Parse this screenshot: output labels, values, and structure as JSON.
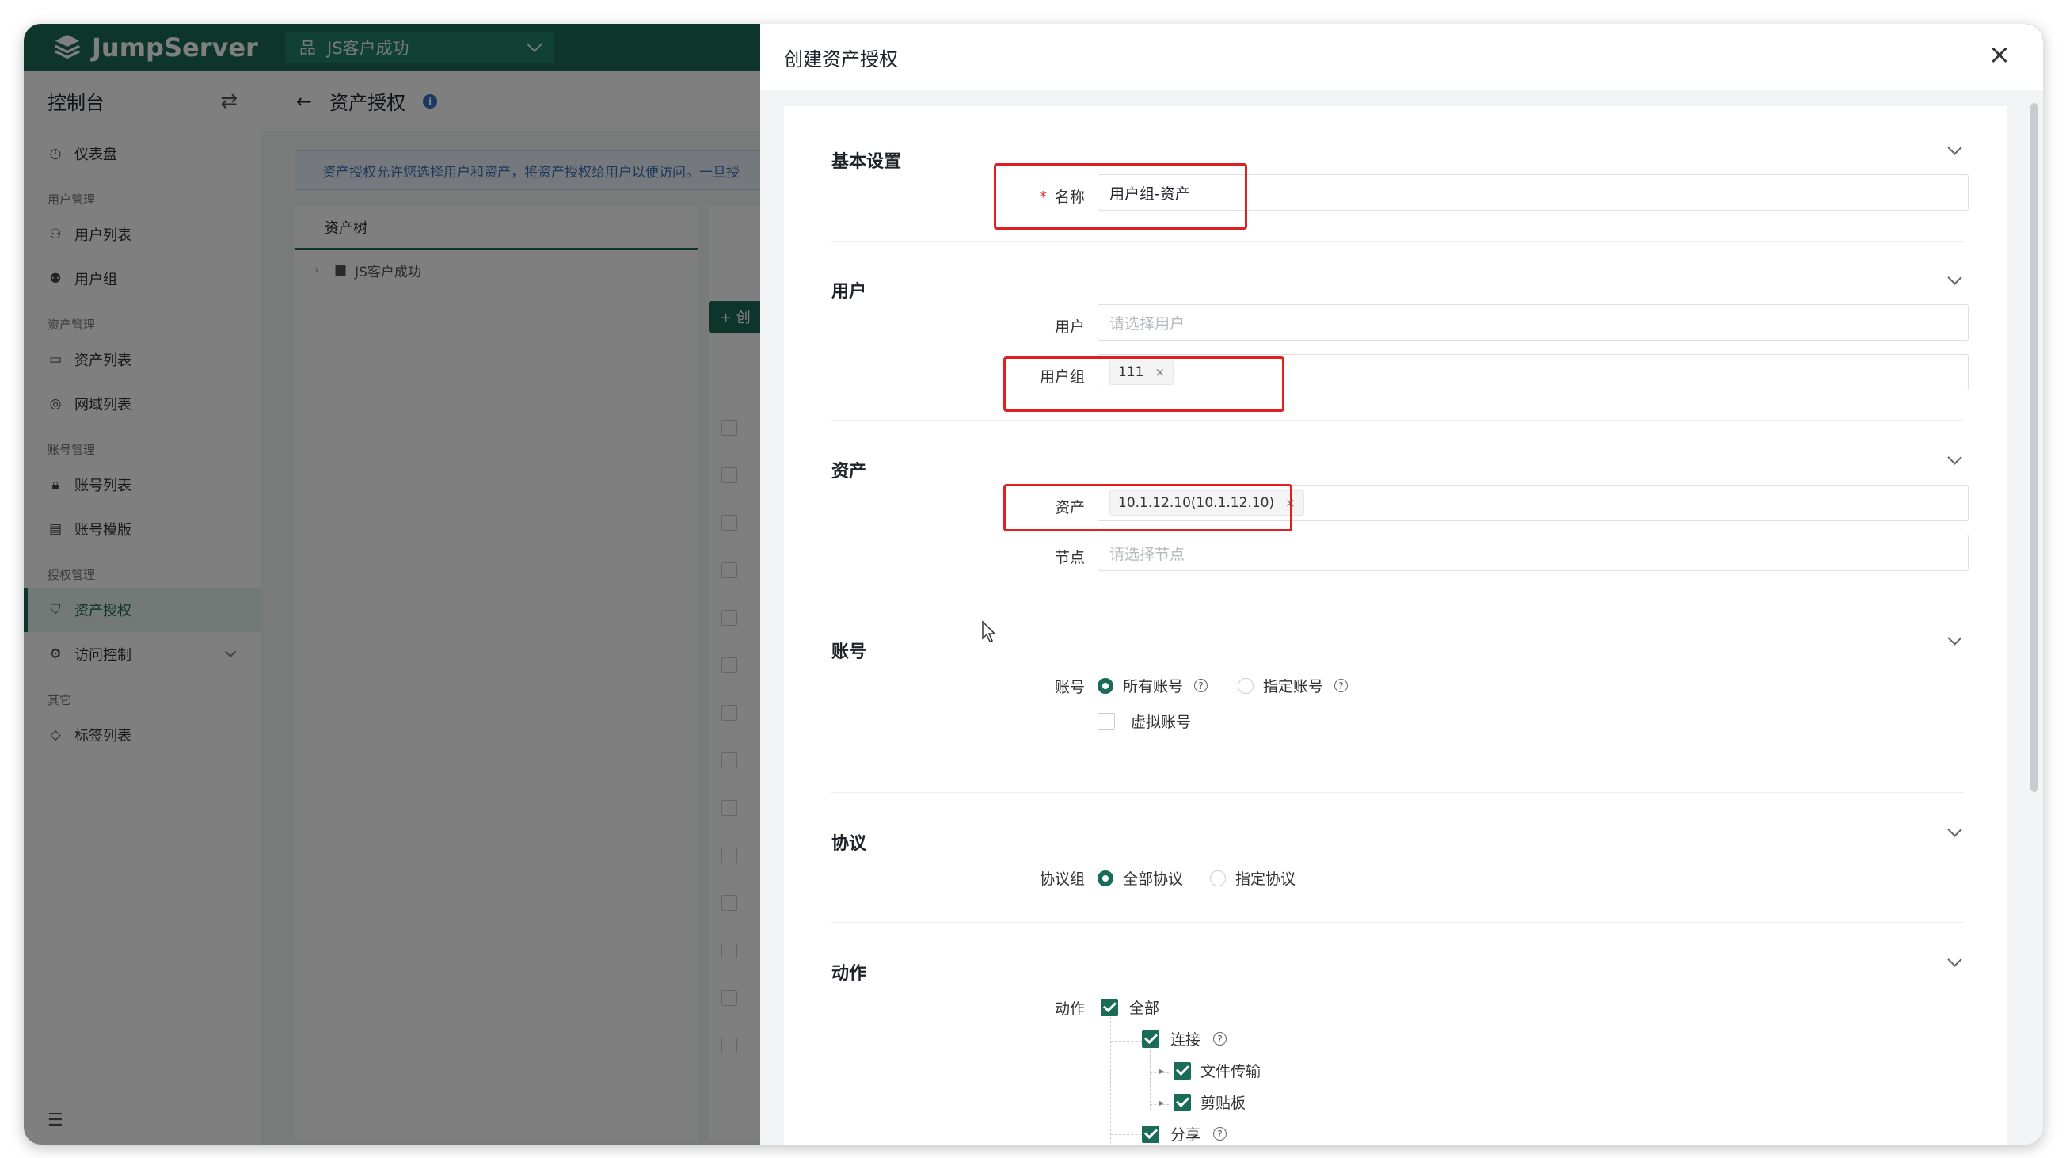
{
  "app": {
    "logo": "JumpServer",
    "org": "JS客户成功"
  },
  "sidebar": {
    "title": "控制台",
    "items": [
      {
        "type": "item",
        "label": "仪表盘",
        "icon": "dashboard-icon"
      },
      {
        "type": "group",
        "label": "用户管理"
      },
      {
        "type": "item",
        "label": "用户列表",
        "icon": "user-icon"
      },
      {
        "type": "item",
        "label": "用户组",
        "icon": "user-group-icon"
      },
      {
        "type": "group",
        "label": "资产管理"
      },
      {
        "type": "item",
        "label": "资产列表",
        "icon": "monitor-icon"
      },
      {
        "type": "item",
        "label": "网域列表",
        "icon": "location-icon"
      },
      {
        "type": "group",
        "label": "账号管理"
      },
      {
        "type": "item",
        "label": "账号列表",
        "icon": "lock-icon"
      },
      {
        "type": "item",
        "label": "账号模版",
        "icon": "template-icon"
      },
      {
        "type": "group",
        "label": "授权管理"
      },
      {
        "type": "item",
        "label": "资产授权",
        "icon": "shield-icon",
        "active": true
      },
      {
        "type": "item",
        "label": "访问控制",
        "icon": "access-control-icon",
        "expandable": true
      },
      {
        "type": "group",
        "label": "其它"
      },
      {
        "type": "item",
        "label": "标签列表",
        "icon": "tag-icon"
      }
    ]
  },
  "page": {
    "title": "资产授权",
    "notice": "资产授权允许您选择用户和资产，将资产授权给用户以便访问。一旦授",
    "tree_tab": "资产树",
    "tree_root": "JS客户成功",
    "create_label": "+ 创"
  },
  "drawer": {
    "title": "创建资产授权",
    "sections": {
      "basic": {
        "title": "基本设置",
        "name_label": "名称",
        "name_value": "用户组-资产"
      },
      "users": {
        "title": "用户",
        "user_label": "用户",
        "user_placeholder": "请选择用户",
        "group_label": "用户组",
        "group_tag": "111"
      },
      "assets": {
        "title": "资产",
        "asset_label": "资产",
        "asset_tag": "10.1.12.10(10.1.12.10)",
        "node_label": "节点",
        "node_placeholder": "请选择节点"
      },
      "accounts": {
        "title": "账号",
        "label": "账号",
        "opt_all": "所有账号",
        "opt_specified": "指定账号",
        "virtual": "虚拟账号"
      },
      "protocols": {
        "title": "协议",
        "label": "协议组",
        "opt_all": "全部协议",
        "opt_specified": "指定协议"
      },
      "actions": {
        "title": "动作",
        "label": "动作",
        "all": "全部",
        "connect": "连接",
        "file_transfer": "文件传输",
        "clipboard": "剪贴板",
        "share": "分享"
      }
    }
  }
}
